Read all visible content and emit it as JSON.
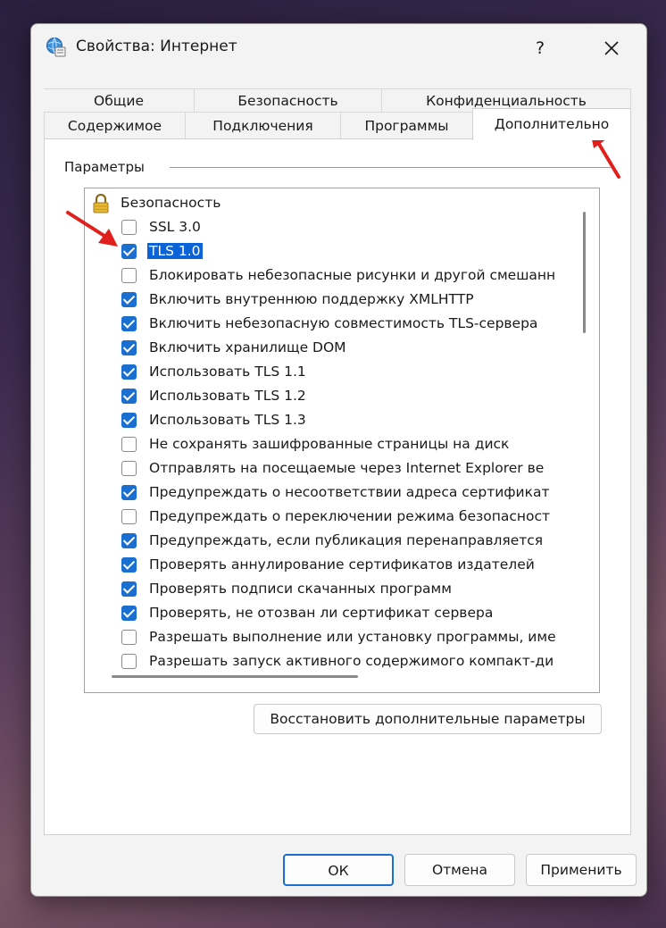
{
  "window": {
    "title": "Свойства: Интернет",
    "help_label": "?",
    "close_label": "✕"
  },
  "tabs": {
    "row1": [
      {
        "label": "Общие"
      },
      {
        "label": "Безопасность"
      },
      {
        "label": "Конфиденциальность"
      }
    ],
    "row2": [
      {
        "label": "Содержимое"
      },
      {
        "label": "Подключения"
      },
      {
        "label": "Программы"
      },
      {
        "label": "Дополнительно",
        "active": true
      }
    ]
  },
  "settings": {
    "group_label": "Параметры",
    "category": "Безопасность",
    "items": [
      {
        "label": "SSL 3.0",
        "checked": false
      },
      {
        "label": "TLS 1.0",
        "checked": true,
        "selected": true
      },
      {
        "label": "Блокировать небезопасные рисунки и другой смешанн",
        "checked": false
      },
      {
        "label": "Включить внутреннюю поддержку XMLHTTP",
        "checked": true
      },
      {
        "label": "Включить небезопасную совместимость TLS-сервера",
        "checked": true
      },
      {
        "label": "Включить хранилище DOM",
        "checked": true
      },
      {
        "label": "Использовать TLS 1.1",
        "checked": true
      },
      {
        "label": "Использовать TLS 1.2",
        "checked": true
      },
      {
        "label": "Использовать TLS 1.3",
        "checked": true
      },
      {
        "label": "Не сохранять зашифрованные страницы на диск",
        "checked": false
      },
      {
        "label": "Отправлять на посещаемые через Internet Explorer ве",
        "checked": false
      },
      {
        "label": "Предупреждать о несоответствии адреса сертификат",
        "checked": true
      },
      {
        "label": "Предупреждать о переключении режима безопасност",
        "checked": false
      },
      {
        "label": "Предупреждать, если публикация перенаправляется",
        "checked": true
      },
      {
        "label": "Проверять аннулирование сертификатов издателей",
        "checked": true
      },
      {
        "label": "Проверять подписи скачанных программ",
        "checked": true
      },
      {
        "label": "Проверять, не отозван ли сертификат сервера",
        "checked": true
      },
      {
        "label": "Разрешать выполнение или установку программы, име",
        "checked": false
      },
      {
        "label": "Разрешать запуск активного содержимого компакт-ди",
        "checked": false
      }
    ]
  },
  "buttons": {
    "restore": "Восстановить дополнительные параметры",
    "ok": "ОК",
    "cancel": "Отмена",
    "apply": "Применить"
  },
  "colors": {
    "accent": "#1a6fd0",
    "selection": "#0a64d8",
    "annotation_arrow": "#e0201c"
  }
}
